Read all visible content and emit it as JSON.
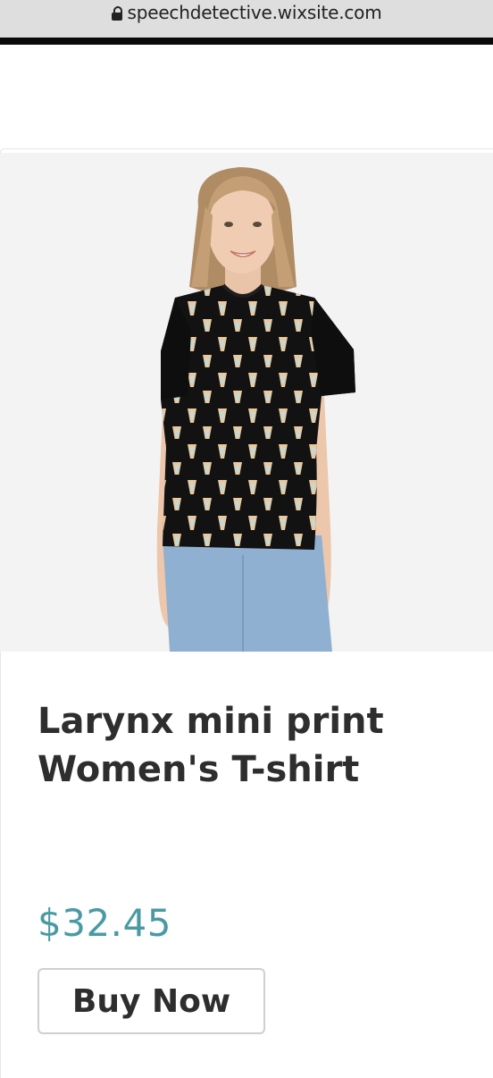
{
  "browser": {
    "url": "speechdetective.wixsite.com",
    "lock_icon": "lock-icon"
  },
  "product": {
    "image_icon": "product-photo",
    "title_line1": "Larynx mini print",
    "title_line2": "Women's T-shirt",
    "price": "$32.45",
    "buy_label": "Buy Now"
  },
  "colors": {
    "price": "#4a9aa3",
    "title": "#2e2e2e",
    "shirt": "#121212"
  }
}
